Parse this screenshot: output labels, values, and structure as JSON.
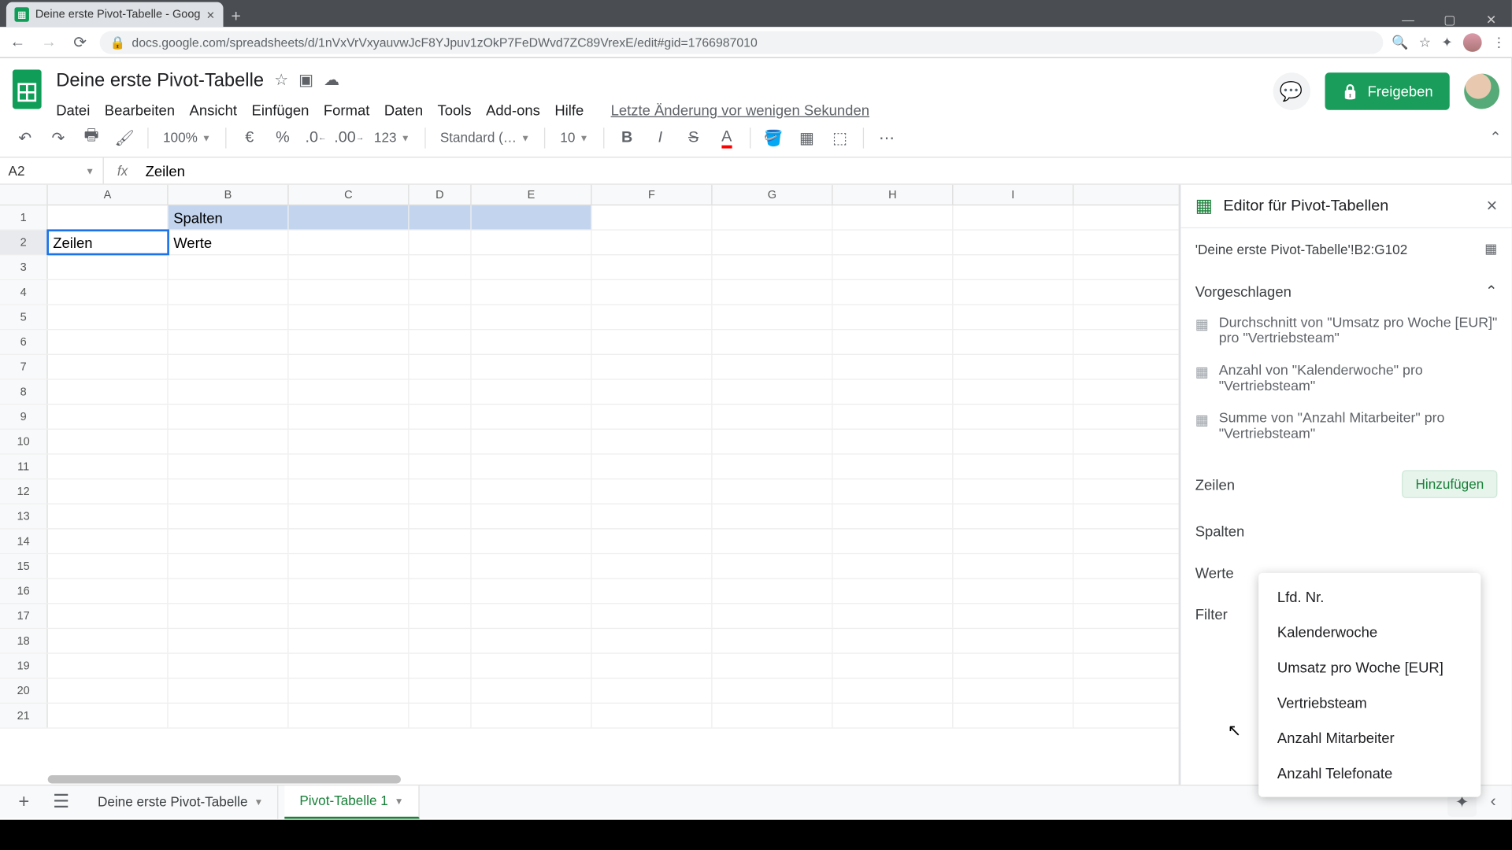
{
  "browser": {
    "tab_title": "Deine erste Pivot-Tabelle - Goog",
    "url": "docs.google.com/spreadsheets/d/1nVxVrVxyauvwJcF8YJpuv1zOkP7FeDWvd7ZC89VrexE/edit#gid=1766987010"
  },
  "doc": {
    "title": "Deine erste Pivot-Tabelle",
    "last_edit": "Letzte Änderung vor wenigen Sekunden"
  },
  "menus": {
    "file": "Datei",
    "edit": "Bearbeiten",
    "view": "Ansicht",
    "insert": "Einfügen",
    "format": "Format",
    "data": "Daten",
    "tools": "Tools",
    "addons": "Add-ons",
    "help": "Hilfe"
  },
  "share_label": "Freigeben",
  "toolbar": {
    "zoom": "100%",
    "currency": "€",
    "percent": "%",
    "dec_dec": ".0",
    "dec_inc": ".00",
    "numfmt": "123",
    "font": "Standard (…",
    "size": "10"
  },
  "fx": {
    "cell_ref": "A2",
    "formula": "Zeilen"
  },
  "grid": {
    "cols": [
      "A",
      "B",
      "C",
      "D",
      "E",
      "F",
      "G",
      "H",
      "I"
    ],
    "rows": [
      "1",
      "2",
      "3",
      "4",
      "5",
      "6",
      "7",
      "8",
      "9",
      "10",
      "11",
      "12",
      "13",
      "14",
      "15",
      "16",
      "17",
      "18",
      "19",
      "20",
      "21"
    ],
    "cells": {
      "B1": "Spalten",
      "A2": "Zeilen",
      "B2": "Werte"
    }
  },
  "pivot": {
    "title": "Editor für Pivot-Tabellen",
    "range": "'Deine erste Pivot-Tabelle'!B2:G102",
    "suggested_label": "Vorgeschlagen",
    "suggestions": [
      "Durchschnitt von \"Umsatz pro Woche [EUR]\" pro \"Vertriebsteam\"",
      "Anzahl von \"Kalenderwoche\" pro \"Vertriebsteam\"",
      "Summe von \"Anzahl Mitarbeiter\" pro \"Vertriebsteam\""
    ],
    "sections": {
      "rows": "Zeilen",
      "cols": "Spalten",
      "values": "Werte",
      "filter": "Filter"
    },
    "add_label": "Hinzufügen",
    "popup_fields": [
      "Lfd. Nr.",
      "Kalenderwoche",
      "Umsatz pro Woche [EUR]",
      "Vertriebsteam",
      "Anzahl Mitarbeiter",
      "Anzahl Telefonate"
    ]
  },
  "sheets": {
    "tab1": "Deine erste Pivot-Tabelle",
    "tab2": "Pivot-Tabelle 1"
  }
}
